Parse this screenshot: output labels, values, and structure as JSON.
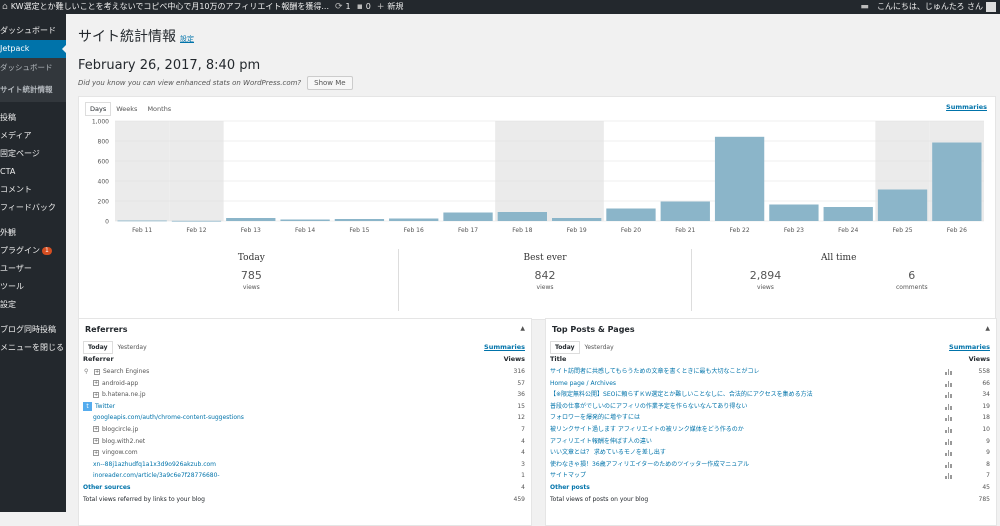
{
  "adminbar": {
    "site_title": "KW選定とか難しいことを考えないでコピペ中心で月10万のアフィリエイト報酬を獲得...",
    "updates_count": "1",
    "comments_count": "0",
    "new_label": "新規",
    "greeting": "こんにちは、じゅんたろ さん"
  },
  "sidebar": {
    "items": [
      {
        "label": "ダッシュボード"
      },
      {
        "label": "Jetpack"
      },
      {
        "label": "ダッシュボード"
      },
      {
        "label": "サイト統計情報"
      },
      {
        "label": "投稿"
      },
      {
        "label": "メディア"
      },
      {
        "label": "固定ページ"
      },
      {
        "label": "CTA"
      },
      {
        "label": "コメント"
      },
      {
        "label": "フィードバック"
      },
      {
        "label": "外観"
      },
      {
        "label": "プラグイン",
        "badge": "1"
      },
      {
        "label": "ユーザー"
      },
      {
        "label": "ツール"
      },
      {
        "label": "設定"
      },
      {
        "label": "ブログ同時投稿"
      },
      {
        "label": "メニューを閉じる"
      }
    ]
  },
  "page": {
    "title": "サイト統計情報",
    "settings_link": "設定",
    "date": "February 26, 2017, 8:40 pm",
    "tip_text": "Did you know you can view enhanced stats on WordPress.com?",
    "show_me": "Show Me"
  },
  "stats": {
    "tabs": [
      "Days",
      "Weeks",
      "Months"
    ],
    "summaries": "Summaries",
    "today": {
      "heading": "Today",
      "value": "785",
      "label": "views"
    },
    "best": {
      "heading": "Best ever",
      "value": "842",
      "label": "views"
    },
    "alltime": {
      "heading": "All time",
      "views_value": "2,894",
      "views_label": "views",
      "comments_value": "6",
      "comments_label": "comments"
    }
  },
  "chart_data": {
    "type": "bar",
    "categories": [
      "Feb 11",
      "Feb 12",
      "Feb 13",
      "Feb 14",
      "Feb 15",
      "Feb 16",
      "Feb 17",
      "Feb 18",
      "Feb 19",
      "Feb 20",
      "Feb 21",
      "Feb 22",
      "Feb 23",
      "Feb 24",
      "Feb 25",
      "Feb 26"
    ],
    "values": [
      5,
      2,
      30,
      15,
      20,
      25,
      85,
      90,
      30,
      125,
      195,
      842,
      165,
      140,
      315,
      785
    ],
    "ylim": [
      0,
      1000
    ],
    "yticks": [
      "0",
      "200",
      "400",
      "600",
      "800",
      "1,000"
    ],
    "grid": true,
    "weekend_shading": [
      "Feb 11",
      "Feb 12",
      "Feb 18",
      "Feb 19",
      "Feb 25",
      "Feb 26"
    ],
    "colors": {
      "bar": "#8bb5c9",
      "shade": "#ebebeb"
    }
  },
  "referrers": {
    "title": "Referrers",
    "tabs": [
      "Today",
      "Yesterday"
    ],
    "summaries": "Summaries",
    "col_left": "Referrer",
    "col_right": "Views",
    "rows": [
      {
        "label": "Search Engines",
        "value": "316",
        "icon": "search-icon",
        "expand": true
      },
      {
        "label": "android-app",
        "value": "57",
        "expand": true
      },
      {
        "label": "b.hatena.ne.jp",
        "value": "36",
        "expand": true
      },
      {
        "label": "Twitter",
        "value": "15",
        "icon": "twitter-icon"
      },
      {
        "label": "googleapis.com/auth/chrome-content-suggestions",
        "value": "12"
      },
      {
        "label": "blogcircle.jp",
        "value": "7",
        "expand": true
      },
      {
        "label": "blog.with2.net",
        "value": "4",
        "expand": true
      },
      {
        "label": "vingow.com",
        "value": "4",
        "expand": true
      },
      {
        "label": "xn--88j1azhudfq1a1x3d9o926akzub.com",
        "value": "3"
      },
      {
        "label": "inoreader.com/article/3a9c6e7f28776680-",
        "value": "1"
      },
      {
        "label": "Other sources",
        "value": "4"
      },
      {
        "label": "Total views referred by links to your blog",
        "value": "459"
      }
    ]
  },
  "top_posts": {
    "title": "Top Posts & Pages",
    "tabs": [
      "Today",
      "Yesterday"
    ],
    "summaries": "Summaries",
    "col_left": "Title",
    "col_right": "Views",
    "rows": [
      {
        "label": "サイト訪問者に共感してもらうための文章を書くときに最も大切なことがコレ",
        "value": "558"
      },
      {
        "label": "Home page / Archives",
        "value": "66"
      },
      {
        "label": "【※限定無料公開】SEOに頼らずＫＷ選定とか難しいことなしに、合法的にアクセスを集める方法",
        "value": "34"
      },
      {
        "label": "普段の仕事がでしいのにアフィリの作業予定を作らないなんてあり得ない",
        "value": "19"
      },
      {
        "label": "フォロワーを爆発的に増やすには",
        "value": "18"
      },
      {
        "label": "被リンクサイト過します アフィリエイトの被リンク媒体をどう作るのか",
        "value": "10"
      },
      {
        "label": "アフィリエイト報酬を伸ばす人の違い",
        "value": "9"
      },
      {
        "label": "いい文章とは？ 求めているモノを差し出す",
        "value": "9"
      },
      {
        "label": "使わなきゃ損！36歳アフィリエイターのためのツイッター作成マニュアル",
        "value": "8"
      },
      {
        "label": "サイトマップ",
        "value": "7"
      },
      {
        "label": "Other posts",
        "value": "45"
      },
      {
        "label": "Total views of posts on your blog",
        "value": "785"
      }
    ]
  }
}
